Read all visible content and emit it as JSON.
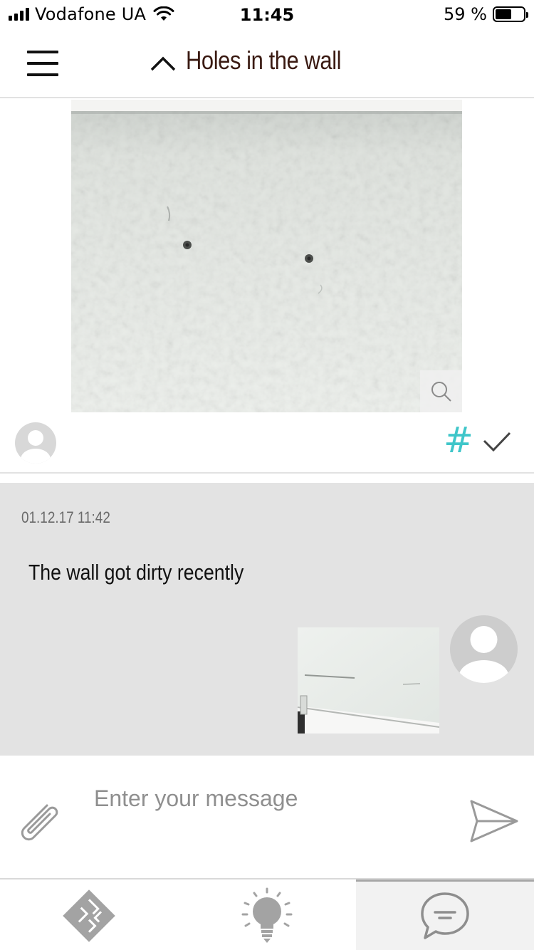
{
  "status_bar": {
    "carrier": "Vodafone UA",
    "time": "11:45",
    "battery_percent": "59 %",
    "battery_level": 0.59
  },
  "header": {
    "title": "Holes in the wall",
    "menu_icon": "hamburger-menu-icon",
    "collapse_icon": "chevron-up-icon"
  },
  "post": {
    "photo_alt": "wall-photo",
    "zoom_icon": "magnifier-icon",
    "hashtag": "#",
    "check_icon": "checkmark-icon"
  },
  "message": {
    "timestamp": "01.12.17 11:42",
    "text": "The wall got dirty recently"
  },
  "compose": {
    "placeholder": "Enter your message",
    "attach_icon": "paperclip-icon",
    "send_icon": "send-icon"
  },
  "tabs": [
    {
      "icon": "floorplan-icon",
      "active": false
    },
    {
      "icon": "lightbulb-icon",
      "active": false
    },
    {
      "icon": "chat-bubble-icon",
      "active": true
    }
  ],
  "colors": {
    "title": "#3a1a12",
    "hashtag": "#3fc6c9",
    "message_bg": "#e3e3e3",
    "icon_gray": "#9a9a9a"
  }
}
